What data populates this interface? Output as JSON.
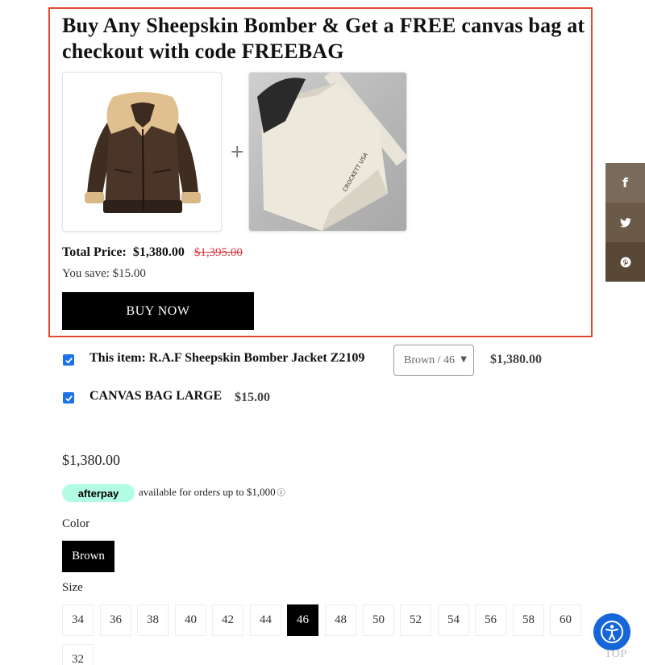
{
  "bundle": {
    "title": "Buy Any Sheepskin Bomber & Get a FREE canvas bag at checkout with code FREEBAG",
    "plus_symbol": "+",
    "total_label": "Total Price:",
    "total_price": "$1,380.00",
    "original_price": "$1,395.00",
    "you_save": "You save: $15.00",
    "buy_now_label": "BUY NOW",
    "bag_print": "CROCKETT USA"
  },
  "items": [
    {
      "label": "This item: R.A.F Sheepskin Bomber Jacket Z2109",
      "variant": "Brown / 46",
      "price": "$1,380.00",
      "checked": true
    },
    {
      "label": "CANVAS BAG LARGE",
      "price": "$15.00",
      "checked": true
    }
  ],
  "product": {
    "price": "$1,380.00",
    "afterpay_logo": "afterpay",
    "afterpay_text": "available for orders up to $1,000",
    "afterpay_info_icon": "ⓘ",
    "color_label": "Color",
    "selected_color": "Brown",
    "size_label": "Size",
    "sizes": [
      "34",
      "36",
      "38",
      "40",
      "42",
      "44",
      "46",
      "48",
      "50",
      "52",
      "54",
      "56",
      "58",
      "60",
      "32"
    ],
    "selected_size": "46"
  },
  "share": {
    "facebook_glyph": "f",
    "icons": [
      "facebook-icon",
      "twitter-icon",
      "pinterest-icon"
    ]
  },
  "back_to_top": "TOP",
  "colors": {
    "highlight_border": "#e0492f",
    "strike_price": "#d9363e",
    "checkbox": "#1a73e8",
    "afterpay_mint": "#b2fce4",
    "accessibility_blue": "#1666d9"
  }
}
